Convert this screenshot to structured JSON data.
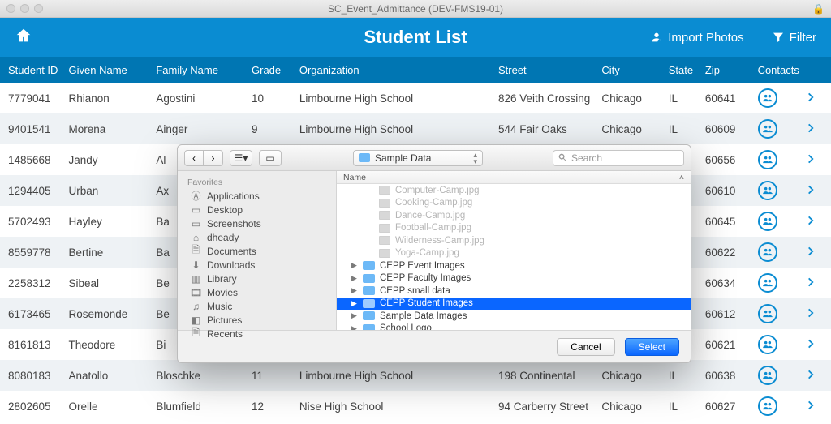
{
  "window": {
    "title": "SC_Event_Admittance (DEV-FMS19-01)"
  },
  "header": {
    "title": "Student List",
    "import_label": "Import Photos",
    "filter_label": "Filter"
  },
  "columns": {
    "id": "Student ID",
    "given": "Given Name",
    "family": "Family Name",
    "grade": "Grade",
    "org": "Organization",
    "street": "Street",
    "city": "City",
    "state": "State",
    "zip": "Zip",
    "contacts": "Contacts"
  },
  "rows": [
    {
      "id": "7779041",
      "given": "Rhianon",
      "family": "Agostini",
      "grade": "10",
      "org": "Limbourne High School",
      "street": "826 Veith Crossing",
      "city": "Chicago",
      "state": "IL",
      "zip": "60641"
    },
    {
      "id": "9401541",
      "given": "Morena",
      "family": "Ainger",
      "grade": "9",
      "org": "Limbourne High School",
      "street": "544 Fair Oaks",
      "city": "Chicago",
      "state": "IL",
      "zip": "60609"
    },
    {
      "id": "1485668",
      "given": "Jandy",
      "family": "Al",
      "grade": "",
      "org": "",
      "street": "",
      "city": "",
      "state": "",
      "zip": "60656"
    },
    {
      "id": "1294405",
      "given": "Urban",
      "family": "Ax",
      "grade": "",
      "org": "",
      "street": "",
      "city": "",
      "state": "",
      "zip": "60610"
    },
    {
      "id": "5702493",
      "given": "Hayley",
      "family": "Ba",
      "grade": "",
      "org": "",
      "street": "",
      "city": "",
      "state": "",
      "zip": "60645"
    },
    {
      "id": "8559778",
      "given": "Bertine",
      "family": "Ba",
      "grade": "",
      "org": "",
      "street": "",
      "city": "",
      "state": "",
      "zip": "60622"
    },
    {
      "id": "2258312",
      "given": "Sibeal",
      "family": "Be",
      "grade": "",
      "org": "",
      "street": "",
      "city": "",
      "state": "",
      "zip": "60634"
    },
    {
      "id": "6173465",
      "given": "Rosemonde",
      "family": "Be",
      "grade": "",
      "org": "",
      "street": "",
      "city": "",
      "state": "",
      "zip": "60612"
    },
    {
      "id": "8161813",
      "given": "Theodore",
      "family": "Bi",
      "grade": "",
      "org": "",
      "street": "",
      "city": "",
      "state": "",
      "zip": "60621"
    },
    {
      "id": "8080183",
      "given": "Anatollo",
      "family": "Bloschke",
      "grade": "11",
      "org": "Limbourne High School",
      "street": "198 Continental",
      "city": "Chicago",
      "state": "IL",
      "zip": "60638"
    },
    {
      "id": "2802605",
      "given": "Orelle",
      "family": "Blumfield",
      "grade": "12",
      "org": "Nise High School",
      "street": "94 Carberry Street",
      "city": "Chicago",
      "state": "IL",
      "zip": "60627"
    }
  ],
  "dialog": {
    "folder_selected": "Sample Data",
    "search_placeholder": "Search",
    "name_header": "Name",
    "favorites_label": "Favorites",
    "favorites": [
      "Applications",
      "Desktop",
      "Screenshots",
      "dheady",
      "Documents",
      "Downloads",
      "Library",
      "Movies",
      "Music",
      "Pictures",
      "Recents"
    ],
    "files_dim": [
      "Computer-Camp.jpg",
      "Cooking-Camp.jpg",
      "Dance-Camp.jpg",
      "Football-Camp.jpg",
      "Wilderness-Camp.jpg",
      "Yoga-Camp.jpg"
    ],
    "folders": [
      {
        "name": "CEPP Event Images",
        "selected": false
      },
      {
        "name": "CEPP Faculty Images",
        "selected": false
      },
      {
        "name": "CEPP small data",
        "selected": false
      },
      {
        "name": "CEPP Student Images",
        "selected": true
      },
      {
        "name": "Sample Data Images",
        "selected": false
      },
      {
        "name": "School Logo",
        "selected": false
      }
    ],
    "cancel_label": "Cancel",
    "select_label": "Select"
  }
}
